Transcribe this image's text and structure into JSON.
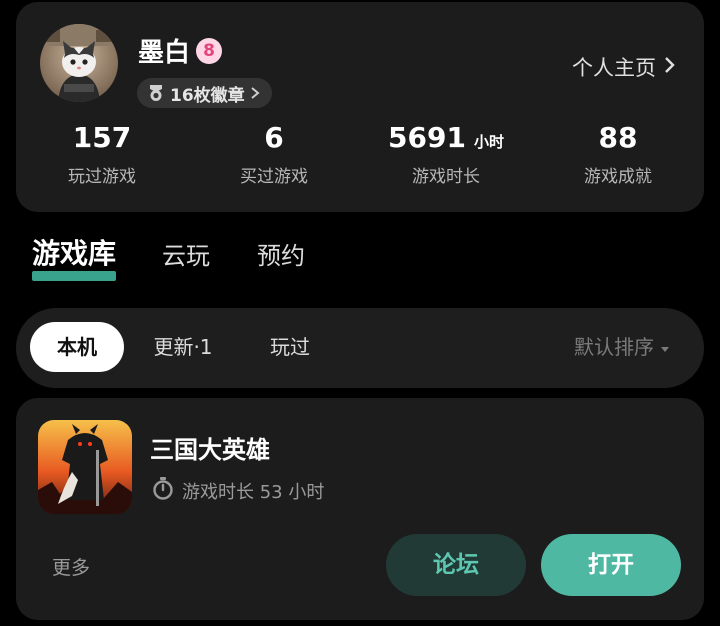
{
  "profile": {
    "username": "墨白",
    "level": "8",
    "badges_label": "16枚徽章",
    "homepage_label": "个人主页",
    "stats": [
      {
        "value": "157",
        "unit": "",
        "label": "玩过游戏"
      },
      {
        "value": "6",
        "unit": "",
        "label": "买过游戏"
      },
      {
        "value": "5691",
        "unit": "小时",
        "label": "游戏时长"
      },
      {
        "value": "88",
        "unit": "",
        "label": "游戏成就"
      }
    ]
  },
  "main_tabs": [
    {
      "label": "游戏库",
      "active": true
    },
    {
      "label": "云玩",
      "active": false
    },
    {
      "label": "预约",
      "active": false
    }
  ],
  "filter": {
    "chips": [
      {
        "label": "本机",
        "selected": true
      },
      {
        "label": "更新·1",
        "selected": false
      },
      {
        "label": "玩过",
        "selected": false
      }
    ],
    "sort_label": "默认排序"
  },
  "game": {
    "title": "三国大英雄",
    "playtime": "游戏时长 53 小时",
    "more_label": "更多",
    "forum_label": "论坛",
    "open_label": "打开"
  },
  "colors": {
    "accent": "#4fb8a3",
    "card_bg": "#1c1c1c",
    "page_bg": "#000000",
    "level_badge": "#ffd6e6"
  },
  "icons": {
    "badge": "medal-icon",
    "timer": "stopwatch-icon",
    "chevron": "chevron-right-icon",
    "sort": "caret-down-icon"
  }
}
